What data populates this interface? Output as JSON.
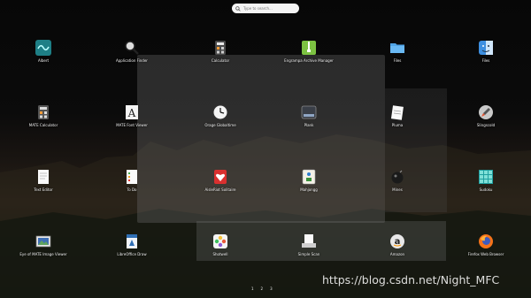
{
  "search": {
    "placeholder": "Type to search..."
  },
  "apps": [
    {
      "label": "Albert",
      "icon": "albert-icon"
    },
    {
      "label": "Application Finder",
      "icon": "magnifier-icon"
    },
    {
      "label": "Calculator",
      "icon": "calculator-icon"
    },
    {
      "label": "Engrampa Archive Manager",
      "icon": "archive-manager-icon"
    },
    {
      "label": "Files",
      "icon": "folder-icon"
    },
    {
      "label": "Files",
      "icon": "finder-icon"
    },
    {
      "label": "MATE Calculator",
      "icon": "mate-calculator-icon"
    },
    {
      "label": "MATE Font Viewer",
      "icon": "font-viewer-icon"
    },
    {
      "label": "Orage Globaltime",
      "icon": "clock-icon"
    },
    {
      "label": "Plank",
      "icon": "plank-icon"
    },
    {
      "label": "Pluma",
      "icon": "pluma-icon"
    },
    {
      "label": "Slingscold",
      "icon": "rocket-icon"
    },
    {
      "label": "Text Editor",
      "icon": "text-editor-icon"
    },
    {
      "label": "To Do",
      "icon": "todo-icon"
    },
    {
      "label": "AisleRiot Solitaire",
      "icon": "solitaire-icon"
    },
    {
      "label": "Mahjongg",
      "icon": "mahjongg-icon"
    },
    {
      "label": "Mines",
      "icon": "mines-icon"
    },
    {
      "label": "Sudoku",
      "icon": "sudoku-icon"
    },
    {
      "label": "Eye of MATE Image Viewer",
      "icon": "image-viewer-icon"
    },
    {
      "label": "LibreOffice Draw",
      "icon": "libreoffice-draw-icon"
    },
    {
      "label": "Shotwell",
      "icon": "shotwell-icon"
    },
    {
      "label": "Simple Scan",
      "icon": "scanner-icon"
    },
    {
      "label": "Amazon",
      "icon": "amazon-icon"
    },
    {
      "label": "Firefox Web Browser",
      "icon": "firefox-icon"
    }
  ],
  "pager": [
    "1",
    "2",
    "3"
  ],
  "watermark": "https://blog.csdn.net/Night_MFC"
}
